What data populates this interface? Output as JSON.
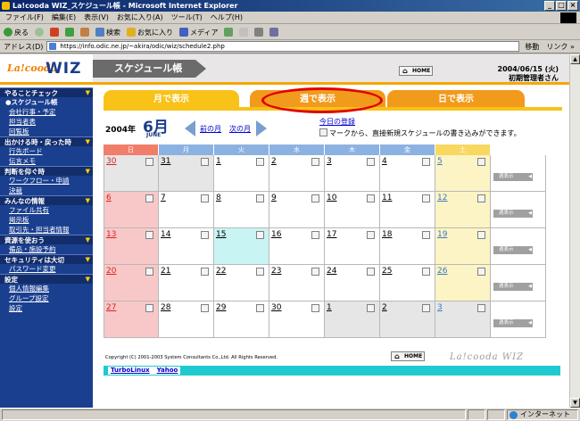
{
  "window": {
    "title": "La!cooda WIZ_スケジュール帳 - Microsoft Internet Explorer",
    "buttons": [
      "_",
      "□",
      "×"
    ]
  },
  "menu": [
    "ファイル(F)",
    "編集(E)",
    "表示(V)",
    "お気に入り(A)",
    "ツール(T)",
    "ヘルプ(H)"
  ],
  "toolbar": {
    "back": "戻る",
    "search": "検索",
    "favorites": "お気に入り",
    "media": "メディア"
  },
  "address": {
    "label": "アドレス(D)",
    "url": "https://info.odic.ne.jp/~akira/odic/wiz/schedule2.php",
    "go": "移動",
    "links": "リンク »"
  },
  "header": {
    "logo_script": "La!cooda",
    "logo_main": "WIZ",
    "page_title": "スケジュール帳",
    "home": "HOME",
    "date": "2004/06/15 (火)",
    "user": "初期管理者さん"
  },
  "sidebar": [
    {
      "title": "やることチェック",
      "items": [
        {
          "label": "●スケジュール帳",
          "current": true
        },
        {
          "label": "会社行事・予定"
        },
        {
          "label": "担当者表"
        },
        {
          "label": "回覧板"
        }
      ]
    },
    {
      "title": "出かける時・戻った時",
      "items": [
        {
          "label": "行先ボード"
        },
        {
          "label": "伝言メモ"
        }
      ]
    },
    {
      "title": "判断を仰ぐ時",
      "items": [
        {
          "label": "ワークフロー・申請"
        },
        {
          "label": "決裁"
        }
      ]
    },
    {
      "title": "みんなの情報",
      "items": [
        {
          "label": "ファイル共有"
        },
        {
          "label": "掲示板"
        },
        {
          "label": "取引先・担当者情報"
        }
      ]
    },
    {
      "title": "資源を使おう",
      "items": [
        {
          "label": "備品・施設予約"
        }
      ]
    },
    {
      "title": "セキュリティは大切",
      "items": [
        {
          "label": "パスワード変更"
        }
      ]
    },
    {
      "title": "設定",
      "items": [
        {
          "label": "個人情報編集"
        },
        {
          "label": "グループ設定"
        },
        {
          "label": "設定"
        }
      ]
    }
  ],
  "tabs": {
    "month": "月で表示",
    "week": "週で表示",
    "day": "日で表示"
  },
  "month_header": {
    "year": "2004年",
    "month": "6月",
    "month_en": "JUNE",
    "prev": "前の月",
    "next": "次の月",
    "today_link": "今日の登録",
    "hint": "マークから、直接新規スケジュールの書き込みができます。"
  },
  "calendar": {
    "weekdays": [
      "日",
      "月",
      "火",
      "水",
      "木",
      "金",
      "土"
    ],
    "week_button": "週表示",
    "weeks": [
      [
        "30",
        "31",
        "1",
        "2",
        "3",
        "4",
        "5"
      ],
      [
        "6",
        "7",
        "8",
        "9",
        "10",
        "11",
        "12"
      ],
      [
        "13",
        "14",
        "15",
        "16",
        "17",
        "18",
        "19"
      ],
      [
        "20",
        "21",
        "22",
        "23",
        "24",
        "25",
        "26"
      ],
      [
        "27",
        "28",
        "29",
        "30",
        "1",
        "2",
        "3"
      ]
    ]
  },
  "footer": {
    "copyright": "Copyright (C) 2001-2003 System Consultants Co.,Ltd. All Rights Reserved.",
    "home": "HOME",
    "logo": "La!cooda WIZ",
    "links": [
      "TurboLinux",
      "Yahoo"
    ]
  },
  "status": {
    "zone": "インターネット"
  }
}
